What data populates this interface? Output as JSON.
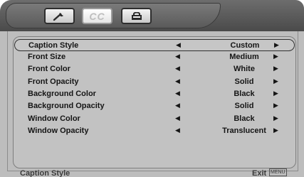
{
  "tabs": [
    {
      "icon": "wrench-icon"
    },
    {
      "label": "CC"
    },
    {
      "icon": "lock-icon"
    }
  ],
  "settings": [
    {
      "label": "Caption  Style",
      "value": "Custom",
      "selected": true
    },
    {
      "label": "Front Size",
      "value": "Medium"
    },
    {
      "label": "Front Color",
      "value": "White"
    },
    {
      "label": "Front Opacity",
      "value": "Solid"
    },
    {
      "label": "Background Color",
      "value": "Black"
    },
    {
      "label": "Background Opacity",
      "value": "Solid"
    },
    {
      "label": "Window Color",
      "value": "Black"
    },
    {
      "label": "Window Opacity",
      "value": "Translucent"
    }
  ],
  "arrows": {
    "left": "◀",
    "right": "▶"
  },
  "status": {
    "title": "Caption Style",
    "exit": "Exit",
    "menu_key": "MENU"
  },
  "colors": {
    "background": "#bdbdbd",
    "tabbar": "#5a5a5a"
  }
}
